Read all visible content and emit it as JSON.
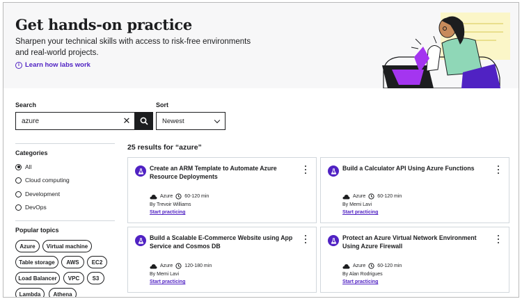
{
  "hero": {
    "title": "Get hands-on practice",
    "subtitle": "Sharpen your technical skills with access to risk-free environments and real-world projects.",
    "link": "Learn how labs work"
  },
  "search": {
    "label": "Search",
    "value": "azure"
  },
  "sort": {
    "label": "Sort",
    "value": "Newest"
  },
  "categories": {
    "title": "Categories",
    "items": [
      {
        "label": "All",
        "selected": true
      },
      {
        "label": "Cloud computing",
        "selected": false
      },
      {
        "label": "Development",
        "selected": false
      },
      {
        "label": "DevOps",
        "selected": false
      }
    ]
  },
  "topics": {
    "title": "Popular topics",
    "items": [
      "Azure",
      "Virtual machine",
      "Table storage",
      "AWS",
      "EC2",
      "Load Balancer",
      "VPC",
      "S3",
      "Lambda",
      "Athena"
    ]
  },
  "results": {
    "summary": "25 results for “azure”",
    "cards": [
      {
        "title": "Create an ARM Template to Automate Azure Resource Deployments",
        "provider": "Azure",
        "duration": "60-120 min",
        "author": "By Trevoir Williams",
        "cta": "Start practicing"
      },
      {
        "title": "Build a Calculator API Using Azure Functions",
        "provider": "Azure",
        "duration": "60-120 min",
        "author": "By Memi Lavi",
        "cta": "Start practicing"
      },
      {
        "title": "Build a Scalable E-Commerce Website using App Service and Cosmos DB",
        "provider": "Azure",
        "duration": "120-180 min",
        "author": "By Memi Lavi",
        "cta": "Start practicing"
      },
      {
        "title": "Protect an Azure Virtual Network Environment Using Azure Firewall",
        "provider": "Azure",
        "duration": "60-120 min",
        "author": "By Alan Rodrigues",
        "cta": "Start practicing"
      }
    ]
  },
  "colors": {
    "accent": "#5022c3",
    "text": "#1c1d1f",
    "hero_bg": "#f7f7f8"
  }
}
